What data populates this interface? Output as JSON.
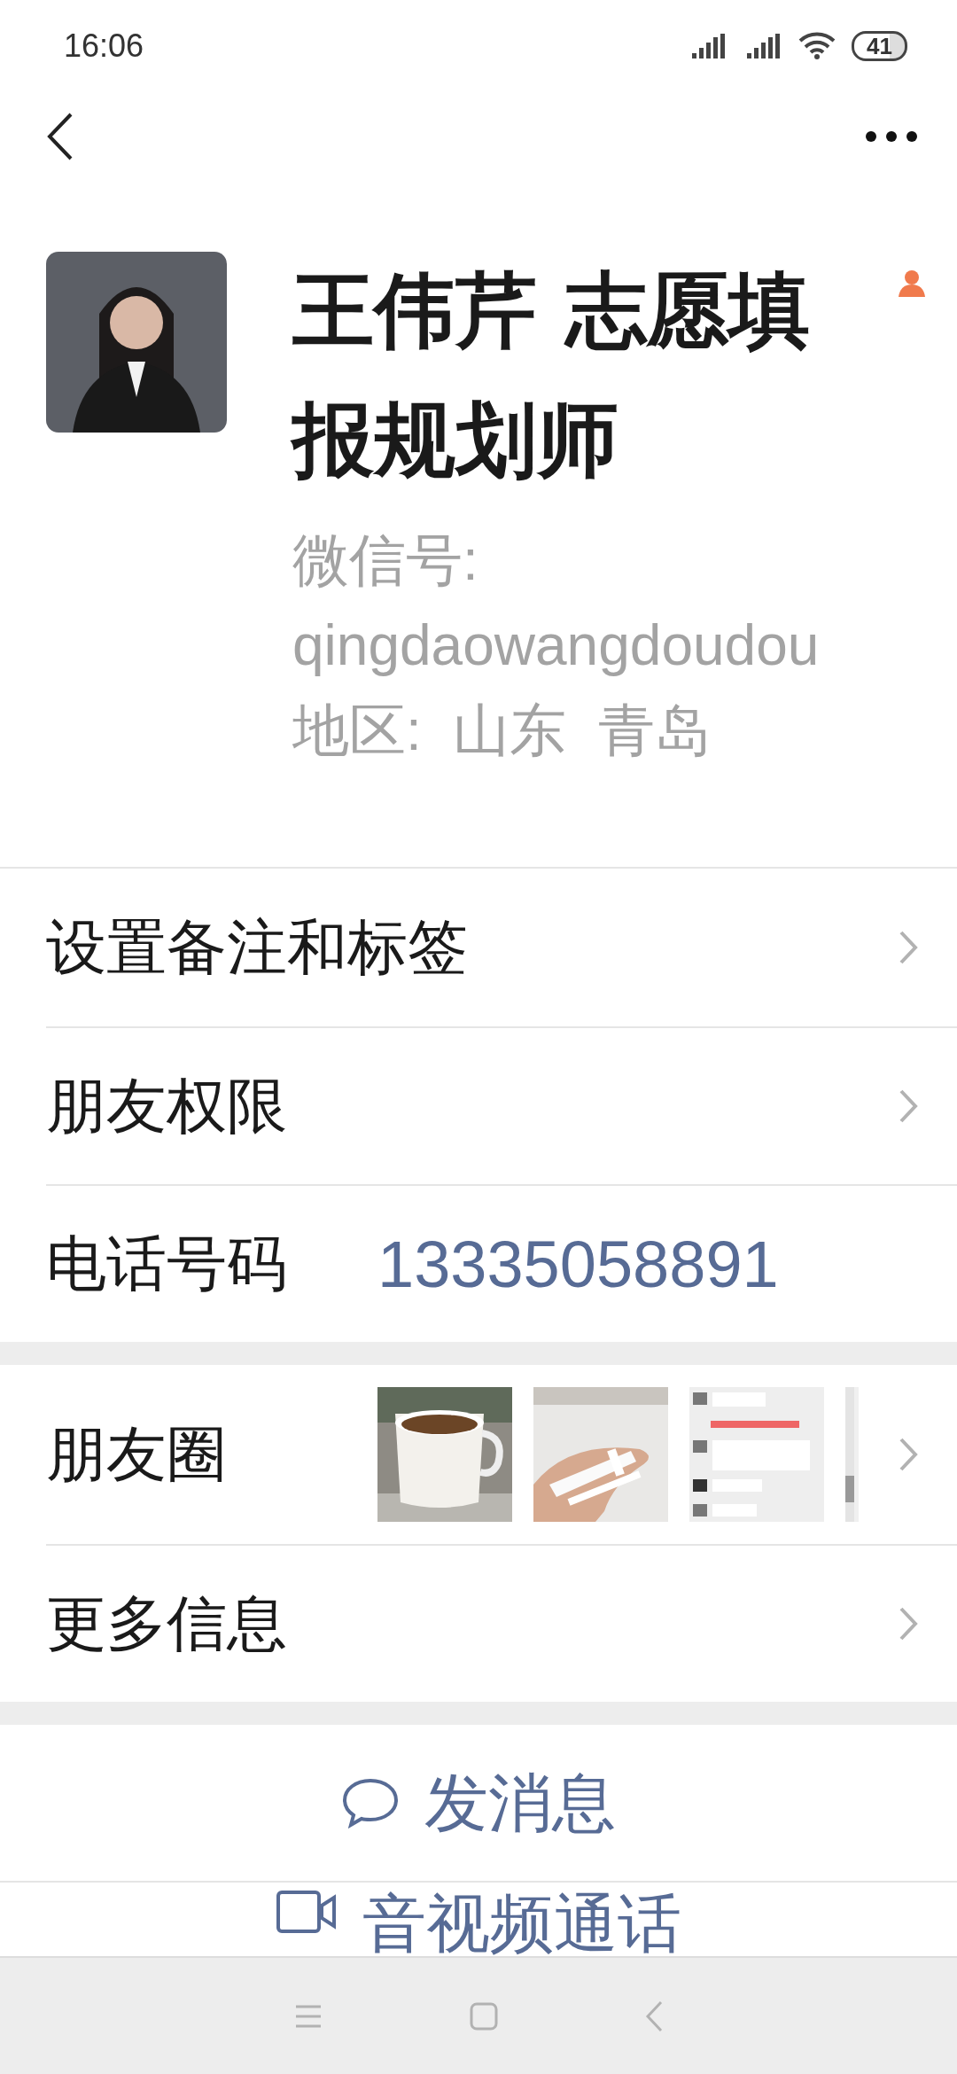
{
  "status_bar": {
    "time": "16:06",
    "battery": "41"
  },
  "profile": {
    "name": "王伟芹 志愿填报规划师",
    "wechat_id": "微信号: qingdaowangdoudou",
    "region": "地区:  山东  青岛"
  },
  "sections": [
    [
      {
        "kind": "link",
        "label": "设置备注和标签"
      },
      {
        "kind": "link",
        "label": "朋友权限"
      },
      {
        "kind": "value",
        "label": "电话号码",
        "value": "13335058891"
      }
    ],
    [
      {
        "kind": "moments",
        "label": "朋友圈"
      },
      {
        "kind": "link",
        "label": "更多信息"
      }
    ]
  ],
  "actions": [
    {
      "kind": "message",
      "label": "发消息"
    },
    {
      "kind": "call",
      "label": "音视频通话"
    }
  ]
}
